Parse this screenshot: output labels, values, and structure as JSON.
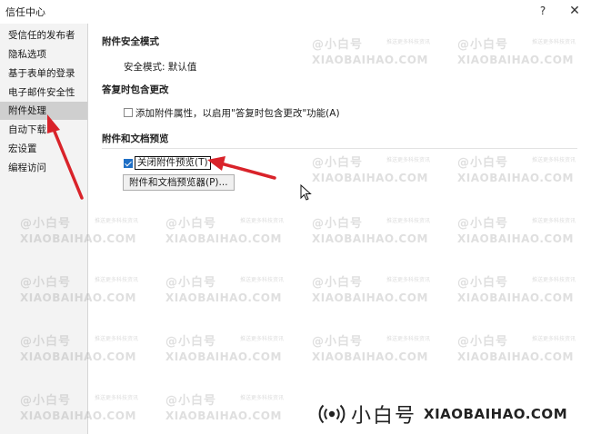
{
  "window": {
    "title": "信任中心",
    "help_glyph": "?",
    "close_glyph": "✕"
  },
  "sidebar": {
    "items": [
      {
        "label": "受信任的发布者"
      },
      {
        "label": "隐私选项"
      },
      {
        "label": "基于表单的登录"
      },
      {
        "label": "电子邮件安全性"
      },
      {
        "label": "附件处理",
        "selected": true
      },
      {
        "label": "自动下载"
      },
      {
        "label": "宏设置"
      },
      {
        "label": "编程访问"
      }
    ]
  },
  "main": {
    "attachment_security": {
      "heading": "附件安全模式",
      "mode_text": "安全模式: 默认值"
    },
    "reply_with_changes": {
      "heading": "答复时包含更改",
      "checkbox_label": "添加附件属性，以启用\"答复时包含更改\"功能(A)",
      "checked": false
    },
    "preview": {
      "heading": "附件和文档预览",
      "checkbox_label": "关闭附件预览(T)",
      "checked": true,
      "button_label": "附件和文档预览器(P)..."
    }
  },
  "watermark": {
    "cn": "@小白号",
    "en": "XIAOBAIHAO.COM",
    "tiny": "推送更多科技资讯"
  },
  "brand": {
    "cn": "小白号",
    "en": "XIAOBAIHAO.COM"
  },
  "colors": {
    "accent": "#1f6fc5",
    "annotation_arrow": "#d9232a",
    "sidebar_bg": "#f3f3f3",
    "sidebar_selected": "#cfcfcf"
  }
}
